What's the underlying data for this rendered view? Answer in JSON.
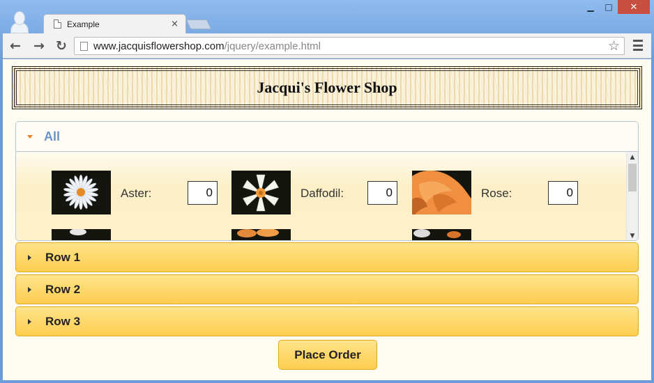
{
  "window": {
    "minimize_glyph": "▁",
    "maximize_glyph": "□",
    "close_glyph": "✕"
  },
  "tab": {
    "title": "Example",
    "close_glyph": "×"
  },
  "toolbar": {
    "back_glyph": "←",
    "forward_glyph": "→",
    "reload_glyph": "↻",
    "star_glyph": "☆",
    "url_host": "www.jacquisflowershop.com",
    "url_path": "/jquery/example.html"
  },
  "banner": {
    "title": "Jacqui's Flower Shop"
  },
  "accordion": {
    "all_label": "All",
    "flowers": [
      {
        "label": "Aster:",
        "quantity": "0",
        "image": "aster-image"
      },
      {
        "label": "Daffodil:",
        "quantity": "0",
        "image": "daffodil-image"
      },
      {
        "label": "Rose:",
        "quantity": "0",
        "image": "rose-image"
      }
    ],
    "rows": [
      {
        "label": "Row 1"
      },
      {
        "label": "Row 2"
      },
      {
        "label": "Row 3"
      }
    ]
  },
  "order_button_label": "Place Order",
  "colors": {
    "panel_accent": "#fecd50",
    "all_label": "#6a93c9",
    "expand_arrow": "#e7812a",
    "close_button": "#c74f3f"
  }
}
